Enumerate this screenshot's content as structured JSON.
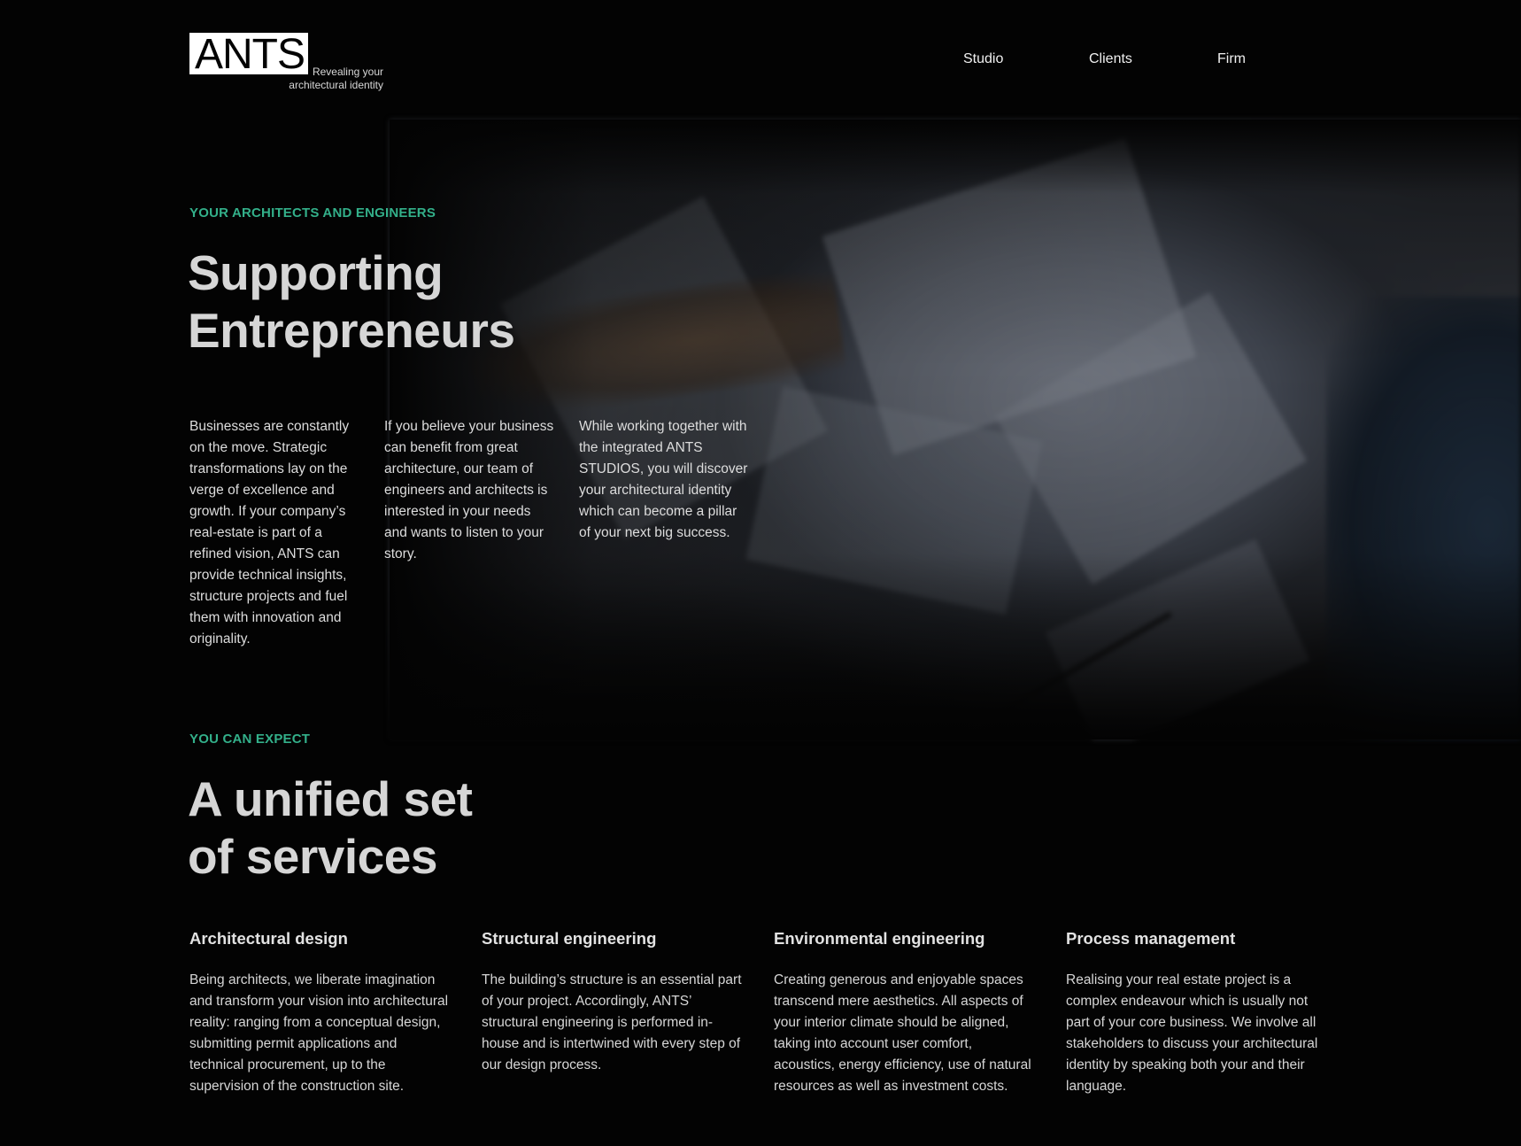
{
  "brand": {
    "logo_text": "ANTS",
    "tagline": "Revealing your\narchitectural identity"
  },
  "nav": {
    "items": [
      {
        "label": "Studio"
      },
      {
        "label": "Clients"
      },
      {
        "label": "Firm"
      }
    ]
  },
  "hero": {
    "eyebrow": "YOUR ARCHITECTS AND ENGINEERS",
    "title_line1": "Supporting",
    "title_line2": "Entrepreneurs",
    "columns": [
      "Businesses are constantly on the move. Strategic transformations lay on the verge of excellence and growth. If your company’s real-estate is part of a refined vision, ANTS can provide technical insights, structure projects and fuel them with innovation and originality.",
      "If you believe your business can benefit from great architecture, our team of engineers and architects is interested in your needs and wants to listen to your story.",
      "While working together with the integrated ANTS STUDIOS, you will discover your architectural identity which can become a pillar of your next big success."
    ]
  },
  "services": {
    "eyebrow": "YOU CAN EXPECT",
    "title_line1": "A unified set",
    "title_line2": "of services",
    "items": [
      {
        "title": "Architectural design",
        "text": "Being architects, we liberate imagination and transform your vision into architectural reality: ranging from a conceptual design, submitting permit applications and technical procurement, up to the supervision of the construction site."
      },
      {
        "title": "Structural engineering",
        "text": "The building’s structure is an essential part of your project. Accordingly, ANTS’ structural engineering is performed in-house and is intertwined with every step of our design process."
      },
      {
        "title": "Environmental engineering",
        "text": "Creating generous and enjoyable spaces transcend mere aesthetics. All aspects of your interior climate should be aligned, taking into account user comfort, acoustics, energy efficiency, use of natural resources as well as investment costs."
      },
      {
        "title": "Process management",
        "text": "Realising your real estate project is a complex endeavour which is usually not part of your core business. We involve all stakeholders to discuss your architectural identity by speaking both your and their language."
      }
    ]
  },
  "colors": {
    "background": "#030303",
    "accent": "#33b08a",
    "heading": "#d6d6d6",
    "logo_bg": "#ffffff"
  }
}
